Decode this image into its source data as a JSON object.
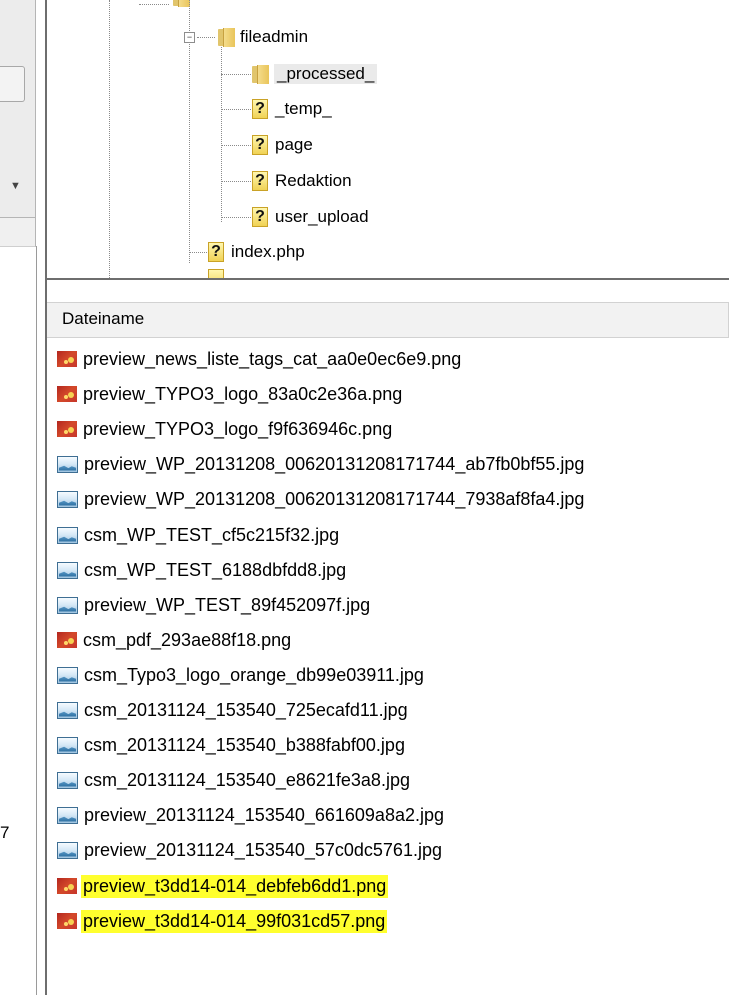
{
  "left_panel": {
    "cut_text": "7"
  },
  "tree": {
    "items": [
      {
        "label": "fileadmin",
        "icon": "folder-icon",
        "expanded": true,
        "selected": false
      },
      {
        "label": "_processed_",
        "icon": "folder-icon",
        "selected": true
      },
      {
        "label": "_temp_",
        "icon": "unknown-file-icon",
        "selected": false
      },
      {
        "label": "page",
        "icon": "unknown-file-icon",
        "selected": false
      },
      {
        "label": "Redaktion",
        "icon": "unknown-file-icon",
        "selected": false
      },
      {
        "label": "user_upload",
        "icon": "unknown-file-icon",
        "selected": false
      },
      {
        "label": "index.php",
        "icon": "unknown-file-icon",
        "selected": false
      }
    ]
  },
  "file_list": {
    "column_header": "Dateiname",
    "highlight_color": "#ffff2e",
    "files": [
      {
        "name": "preview_news_liste_tags_cat_aa0e0ec6e9.png",
        "type": "png",
        "highlighted": false
      },
      {
        "name": "preview_TYPO3_logo_83a0c2e36a.png",
        "type": "png",
        "highlighted": false
      },
      {
        "name": "preview_TYPO3_logo_f9f636946c.png",
        "type": "png",
        "highlighted": false
      },
      {
        "name": "preview_WP_20131208_00620131208171744_ab7fb0bf55.jpg",
        "type": "jpg",
        "highlighted": false
      },
      {
        "name": "preview_WP_20131208_00620131208171744_7938af8fa4.jpg",
        "type": "jpg",
        "highlighted": false
      },
      {
        "name": "csm_WP_TEST_cf5c215f32.jpg",
        "type": "jpg",
        "highlighted": false
      },
      {
        "name": "csm_WP_TEST_6188dbfdd8.jpg",
        "type": "jpg",
        "highlighted": false
      },
      {
        "name": "preview_WP_TEST_89f452097f.jpg",
        "type": "jpg",
        "highlighted": false
      },
      {
        "name": "csm_pdf_293ae88f18.png",
        "type": "png",
        "highlighted": false
      },
      {
        "name": "csm_Typo3_logo_orange_db99e03911.jpg",
        "type": "jpg",
        "highlighted": false
      },
      {
        "name": "csm_20131124_153540_725ecafd11.jpg",
        "type": "jpg",
        "highlighted": false
      },
      {
        "name": "csm_20131124_153540_b388fabf00.jpg",
        "type": "jpg",
        "highlighted": false
      },
      {
        "name": "csm_20131124_153540_e8621fe3a8.jpg",
        "type": "jpg",
        "highlighted": false
      },
      {
        "name": "preview_20131124_153540_661609a8a2.jpg",
        "type": "jpg",
        "highlighted": false
      },
      {
        "name": "preview_20131124_153540_57c0dc5761.jpg",
        "type": "jpg",
        "highlighted": false
      },
      {
        "name": "preview_t3dd14-014_debfeb6dd1.png",
        "type": "png",
        "highlighted": true
      },
      {
        "name": "preview_t3dd14-014_99f031cd57.png",
        "type": "png",
        "highlighted": true
      }
    ]
  }
}
